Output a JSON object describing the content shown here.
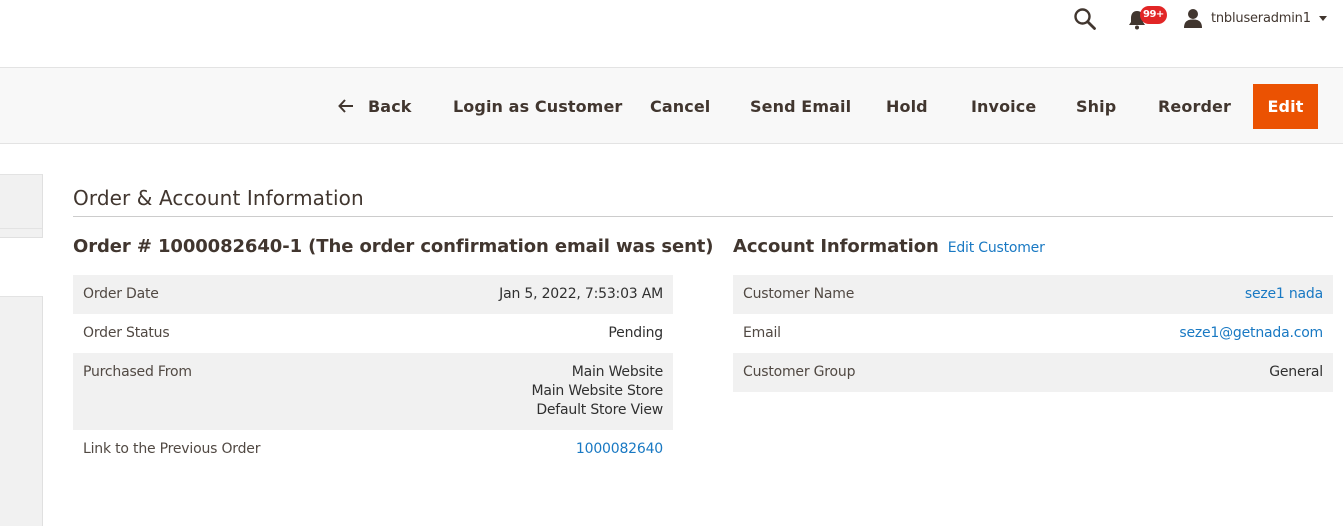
{
  "header": {
    "search_icon": "search-icon",
    "notifications": {
      "icon": "bell-icon",
      "badge": "99+"
    },
    "user": {
      "icon": "user-icon",
      "name": "tnbluseradmin1",
      "dropdown_icon": "caret-down-icon"
    }
  },
  "toolbar": {
    "back": {
      "icon": "arrow-left-icon",
      "label": "Back"
    },
    "login_as_customer": "Login as Customer",
    "cancel": "Cancel",
    "send_email": "Send Email",
    "hold": "Hold",
    "invoice": "Invoice",
    "ship": "Ship",
    "reorder": "Reorder",
    "edit": "Edit"
  },
  "colors": {
    "primary_action": "#eb5202",
    "link": "#1979c3",
    "text": "#41362f",
    "striped_row": "#f1f1f1",
    "badge": "#e22626"
  },
  "section": {
    "title": "Order & Account Information"
  },
  "order": {
    "title": "Order # 1000082640-1 (The order confirmation email was sent)",
    "rows": [
      {
        "label": "Order Date",
        "value": "Jan 5, 2022, 7:53:03 AM"
      },
      {
        "label": "Order Status",
        "value": "Pending"
      },
      {
        "label": "Purchased From",
        "lines": [
          "Main Website",
          "Main Website Store",
          "Default Store View"
        ]
      },
      {
        "label": "Link to the Previous Order",
        "value": "1000082640",
        "is_link": true
      }
    ]
  },
  "account": {
    "title": "Account Information",
    "edit_link": "Edit Customer",
    "rows": [
      {
        "label": "Customer Name",
        "value": "seze1 nada",
        "is_link": true
      },
      {
        "label": "Email",
        "value": "seze1@getnada.com",
        "is_link": true
      },
      {
        "label": "Customer Group",
        "value": "General"
      }
    ]
  }
}
